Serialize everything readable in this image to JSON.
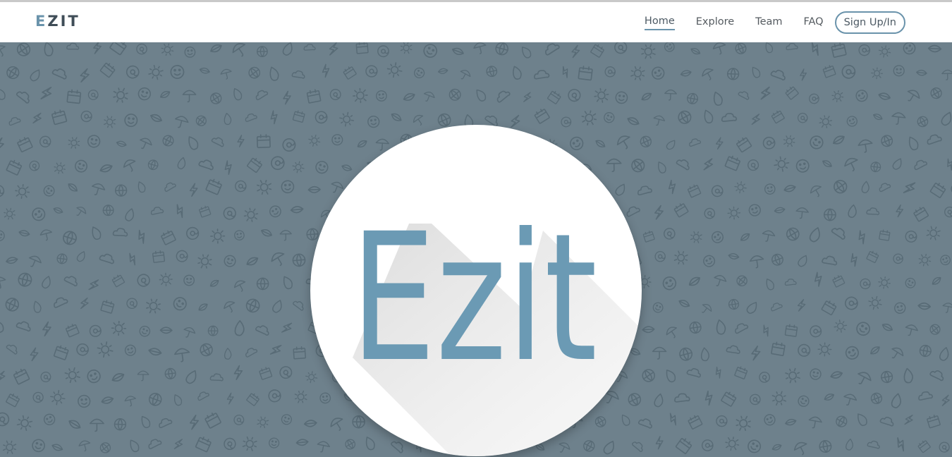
{
  "navbar": {
    "brand": "EZIT",
    "brand_first": "E",
    "brand_rest": "ZIT",
    "links": [
      {
        "label": "Home",
        "active": true
      },
      {
        "label": "Explore",
        "active": false
      },
      {
        "label": "Team",
        "active": false
      },
      {
        "label": "FAQ",
        "active": false
      }
    ],
    "signup_label": "Sign Up/In"
  },
  "hero": {
    "logo_text": "Ezit",
    "background_color": "#6e818c",
    "pattern_icons": [
      "umbrella-icon",
      "sun-icon",
      "lightning-icon",
      "globe-icon",
      "smiley-icon",
      "calendar-icon",
      "flame-icon",
      "leaf-icon",
      "at-icon",
      "cloud-icon"
    ]
  },
  "colors": {
    "accent": "#6a93ab",
    "logo_fill": "#6b9ab4",
    "nav_text": "#555b60"
  }
}
